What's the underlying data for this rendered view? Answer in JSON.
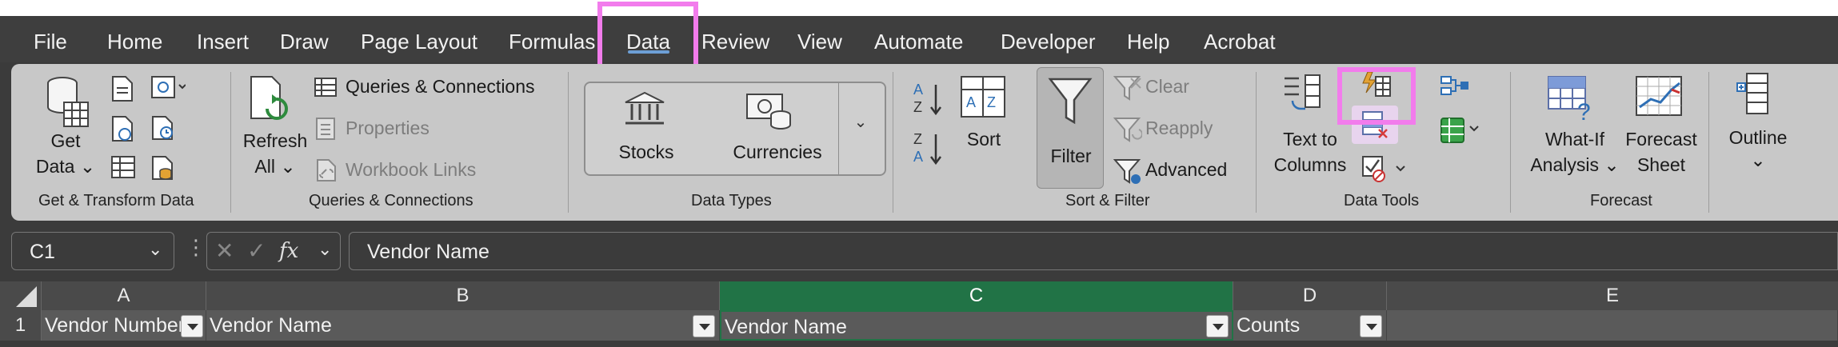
{
  "menu": {
    "file": "File",
    "home": "Home",
    "insert": "Insert",
    "draw": "Draw",
    "page_layout": "Page Layout",
    "formulas": "Formulas",
    "data": "Data",
    "review": "Review",
    "view": "View",
    "automate": "Automate",
    "developer": "Developer",
    "help": "Help",
    "acrobat": "Acrobat"
  },
  "ribbon": {
    "get_transform": {
      "get_data_line1": "Get",
      "get_data_line2": "Data",
      "group_label": "Get & Transform Data"
    },
    "queries": {
      "refresh_line1": "Refresh",
      "refresh_line2": "All",
      "queries_connections": "Queries & Connections",
      "properties": "Properties",
      "workbook_links": "Workbook Links",
      "group_label": "Queries & Connections"
    },
    "data_types": {
      "stocks": "Stocks",
      "currencies": "Currencies",
      "group_label": "Data Types"
    },
    "sort_filter": {
      "sort": "Sort",
      "filter": "Filter",
      "clear": "Clear",
      "reapply": "Reapply",
      "advanced": "Advanced",
      "group_label": "Sort & Filter"
    },
    "data_tools": {
      "text_to_columns_line1": "Text to",
      "text_to_columns_line2": "Columns",
      "group_label": "Data Tools"
    },
    "forecast": {
      "what_if_line1": "What-If",
      "what_if_line2": "Analysis",
      "forecast_sheet_line1": "Forecast",
      "forecast_sheet_line2": "Sheet",
      "group_label": "Forecast"
    },
    "outline": {
      "label": "Outline"
    }
  },
  "formula_bar": {
    "name_box": "C1",
    "fx": "fx",
    "content": "Vendor Name"
  },
  "sheet": {
    "columns": [
      "A",
      "B",
      "C",
      "D",
      "E"
    ],
    "row_number": "1",
    "cells": [
      "Vendor Number",
      "Vendor Name",
      "Vendor Name",
      "Counts"
    ]
  },
  "colors": {
    "highlight": "#f27cec",
    "selected_column": "#217346",
    "ribbon": "#c8c8c8"
  }
}
